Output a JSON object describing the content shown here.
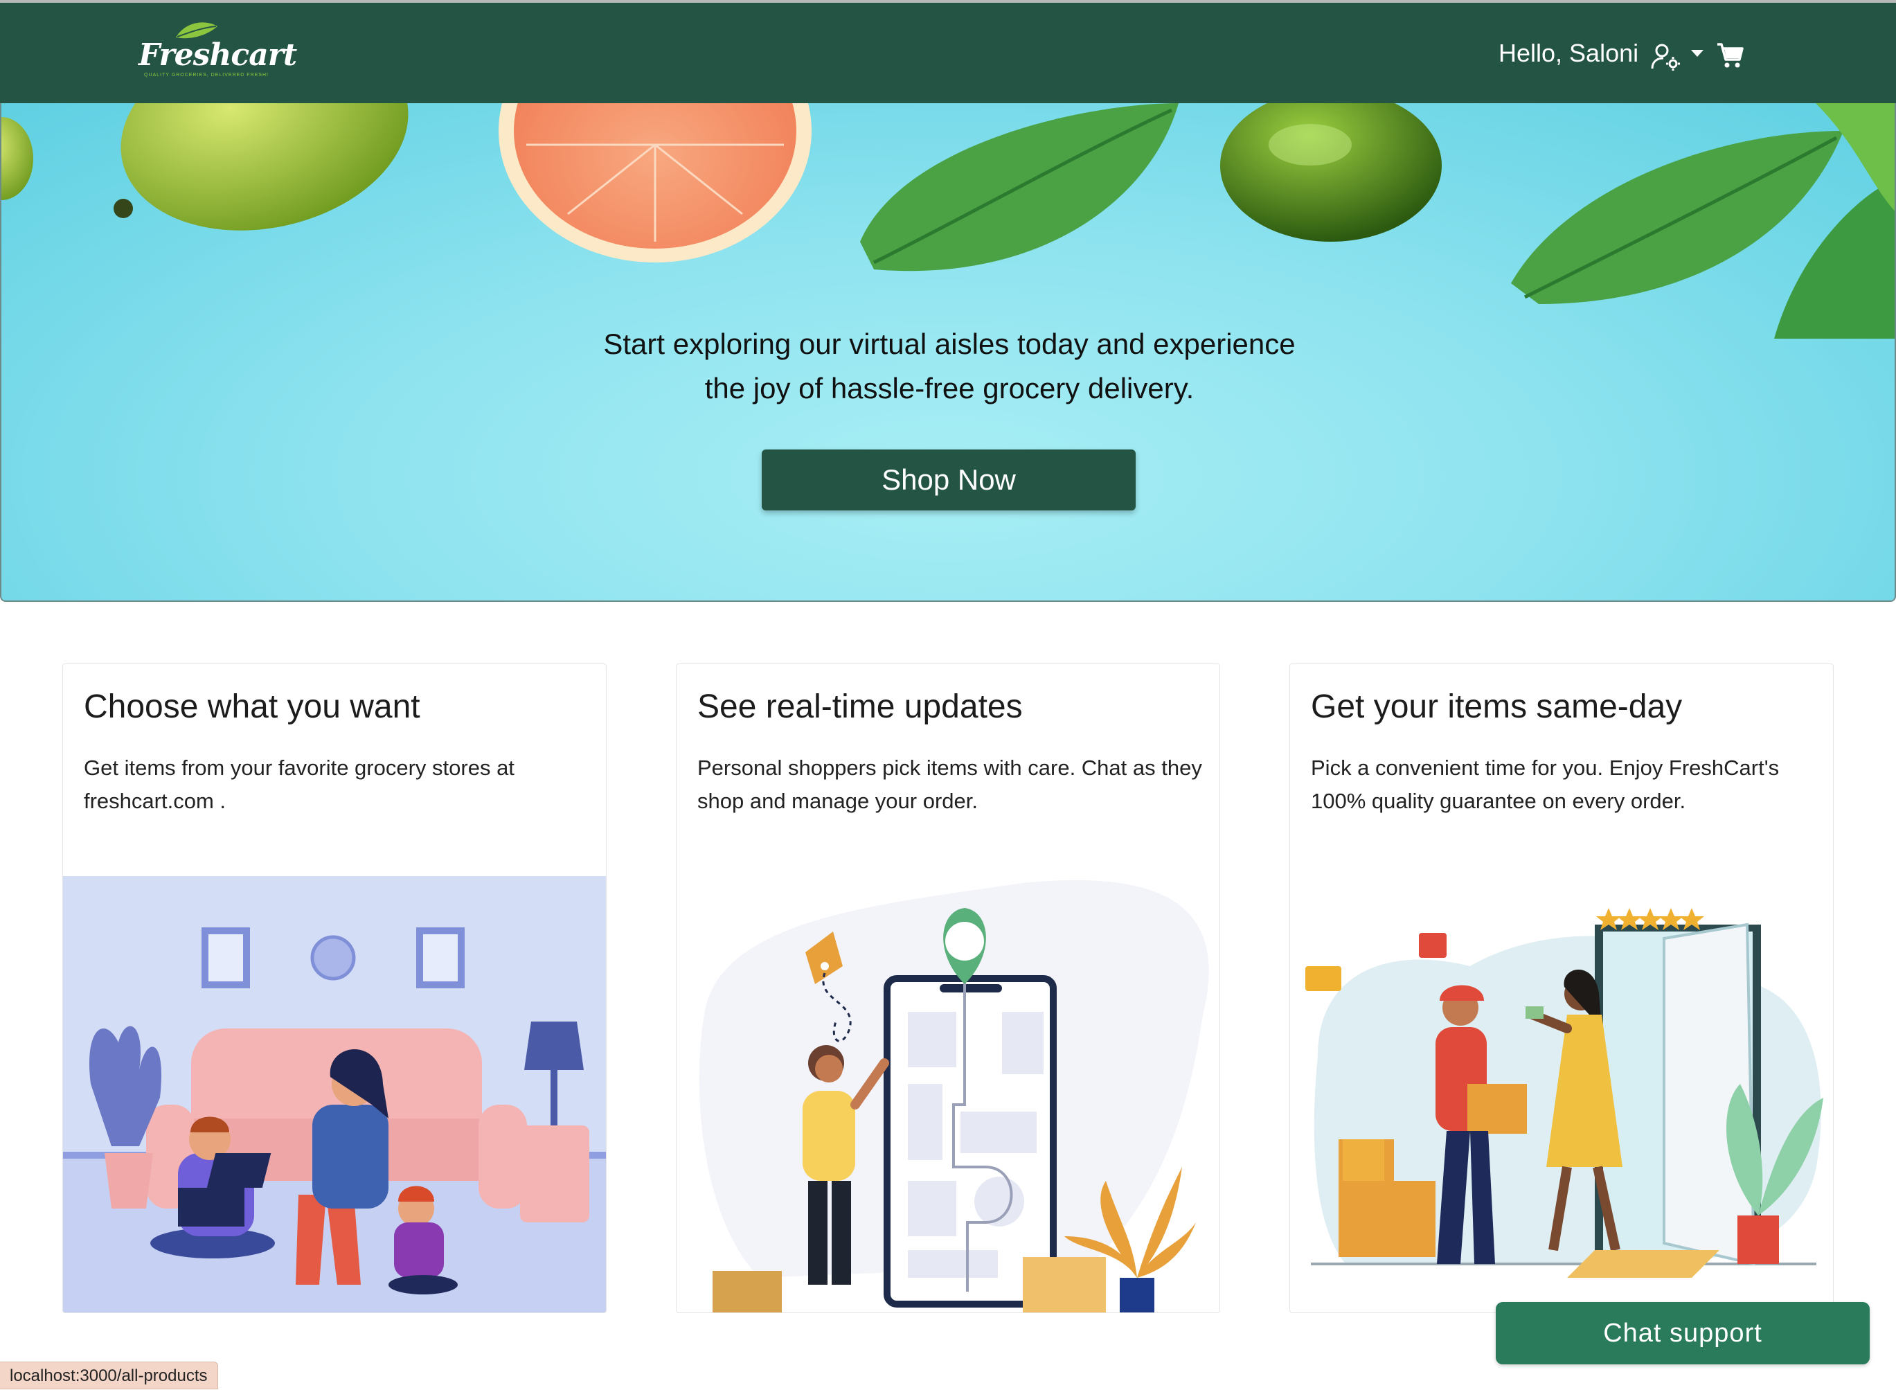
{
  "navbar": {
    "logo_text": "Freshcart",
    "logo_tagline": "QUALITY GROCERIES, DELIVERED FRESH!",
    "greeting": "Hello, Saloni",
    "user_icon": "user-settings-icon",
    "cart_icon": "cart-icon"
  },
  "hero": {
    "line1": "Start exploring our virtual aisles today and experience",
    "line2": "the joy of hassle-free grocery delivery.",
    "cta": "Shop Now"
  },
  "cards": [
    {
      "title": "Choose what you want",
      "text": "Get items from your favorite grocery stores at freshcart.com ."
    },
    {
      "title": "See real-time updates",
      "text": "Personal shoppers pick items with care. Chat as they shop and manage your order."
    },
    {
      "title": "Get your items same-day",
      "text": "Pick a convenient time for you. Enjoy FreshCart's 100% quality guarantee on every order."
    }
  ],
  "chat": {
    "label": "Chat support"
  },
  "status_bar": {
    "url": "localhost:3000/all-products"
  },
  "colors": {
    "primary": "#245544",
    "chat": "#2a7a5c",
    "hero_bg": "#8ee3ef"
  }
}
